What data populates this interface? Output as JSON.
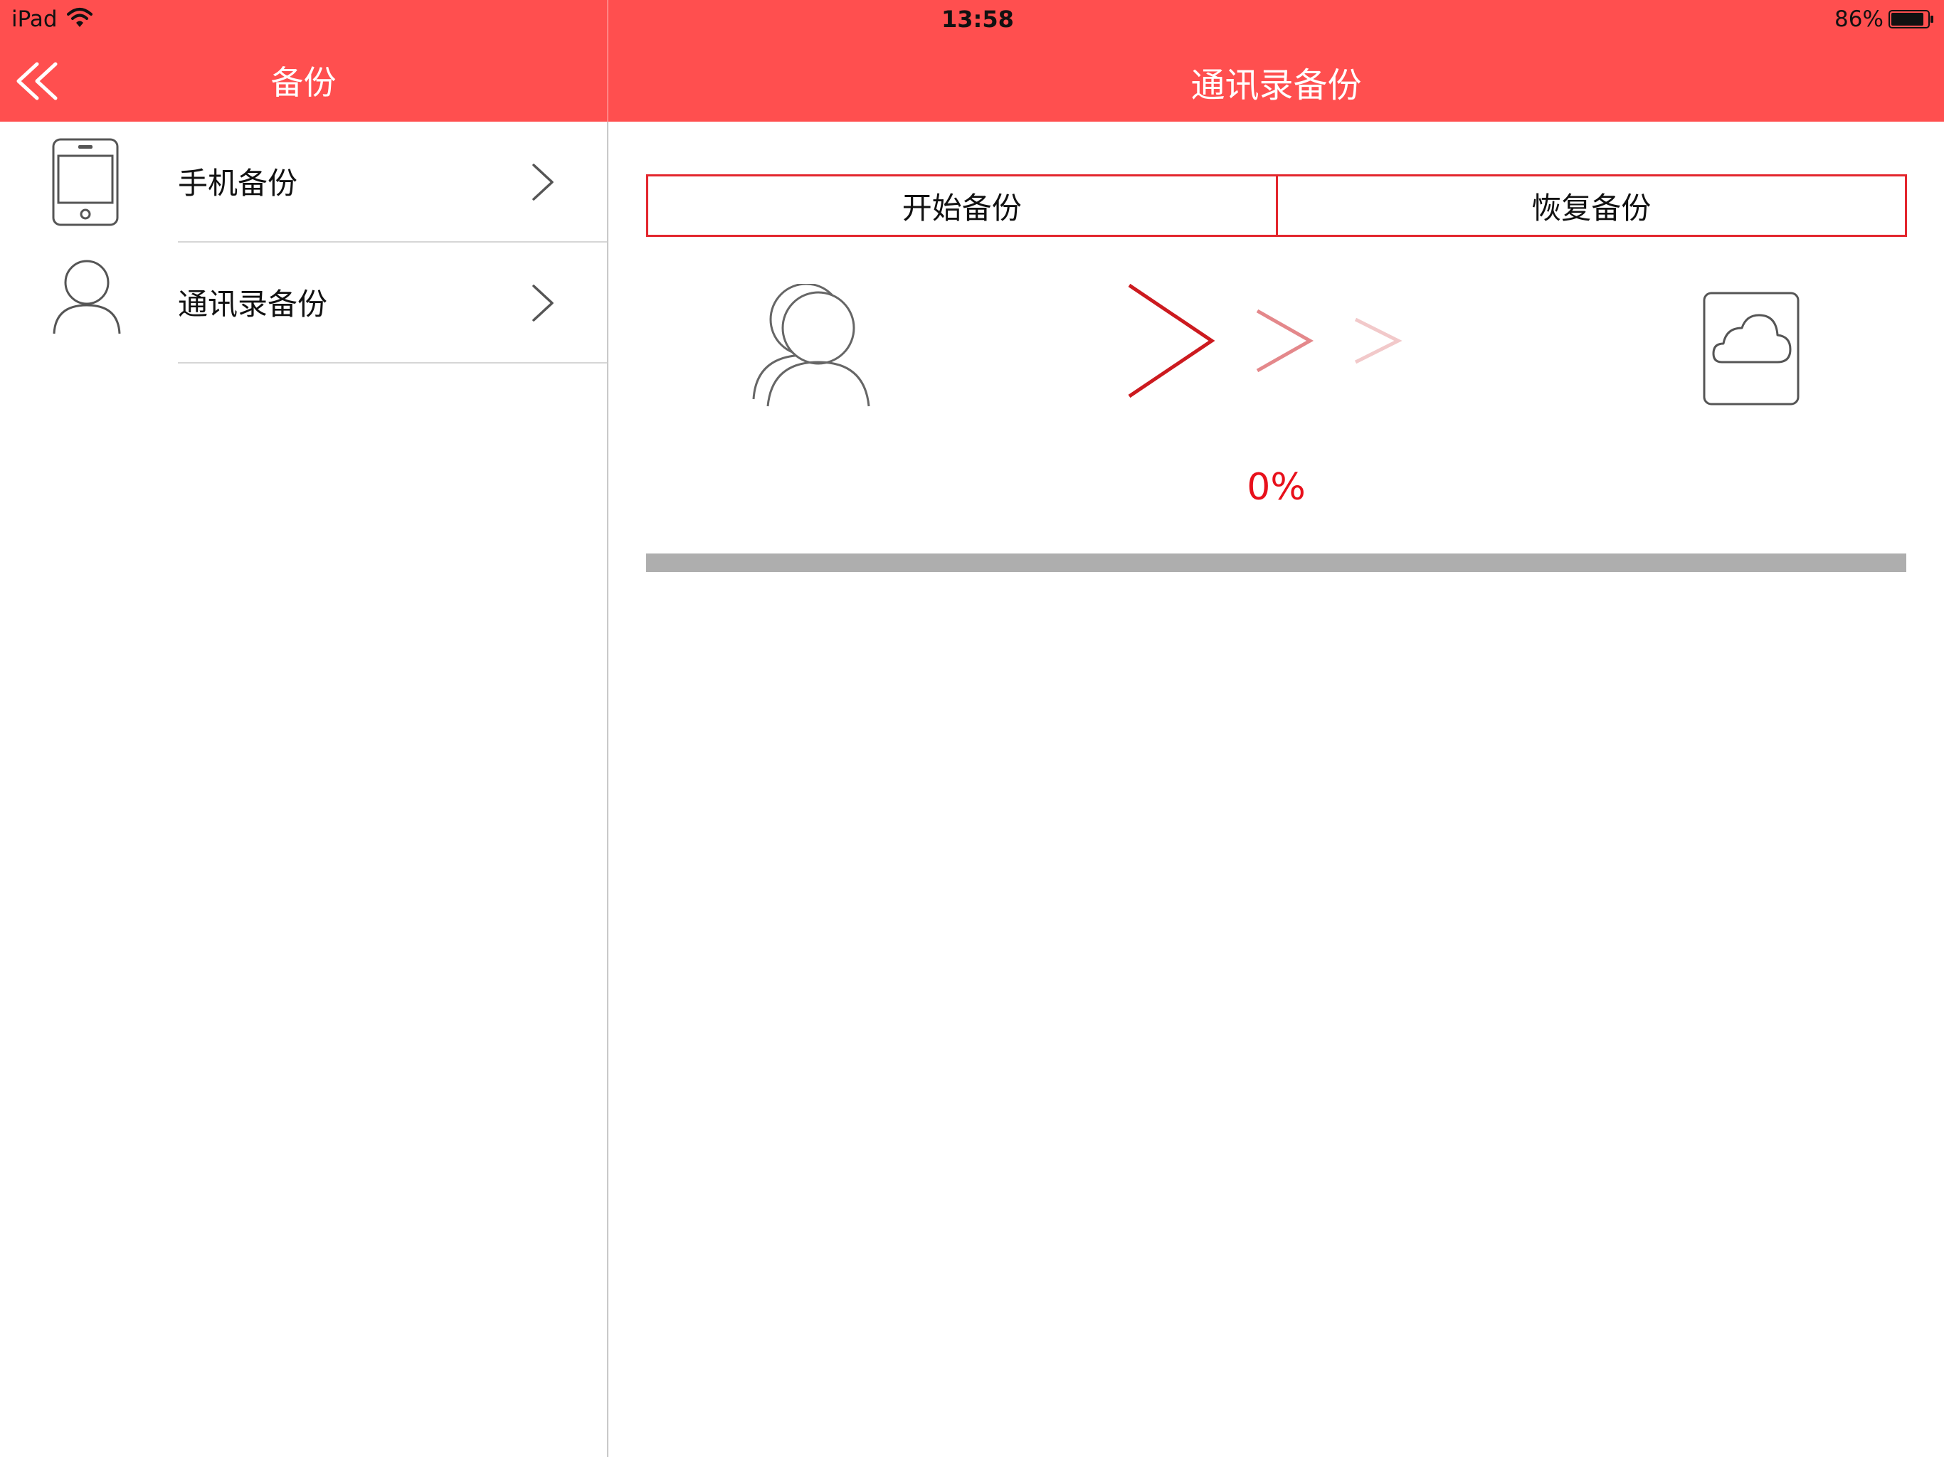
{
  "status_bar": {
    "device": "iPad",
    "time": "13:58",
    "battery": "86%"
  },
  "nav": {
    "left_title": "备份",
    "right_title": "通讯录备份"
  },
  "sidebar": {
    "items": [
      {
        "label": "手机备份",
        "icon": "phone-icon"
      },
      {
        "label": "通讯录备份",
        "icon": "person-icon"
      }
    ]
  },
  "detail": {
    "segments": [
      "开始备份",
      "恢复备份"
    ],
    "progress_text": "0%",
    "progress_value": 0
  },
  "colors": {
    "accent": "#ff4f4f",
    "progress_red": "#e8101b"
  }
}
